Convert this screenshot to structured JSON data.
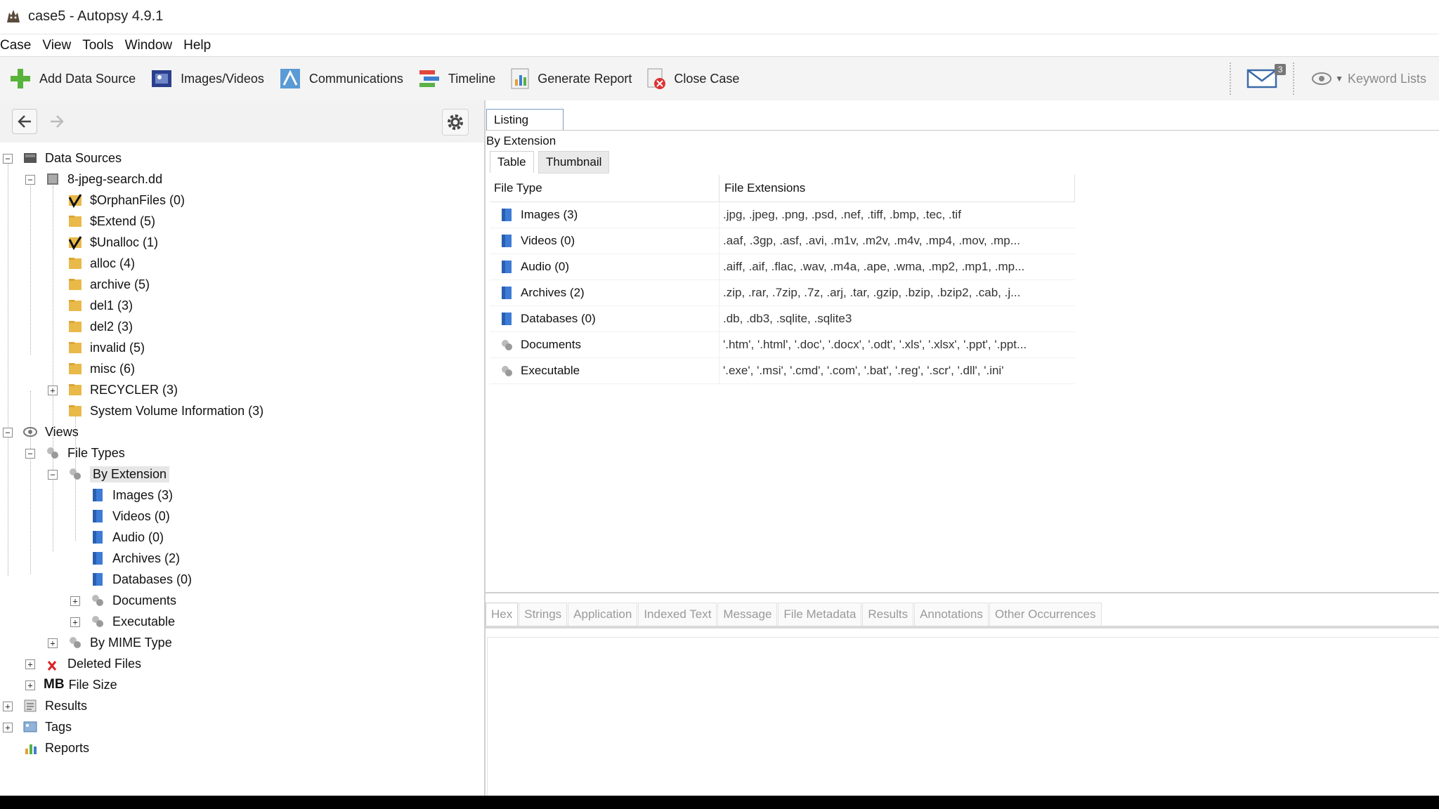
{
  "window": {
    "title": "case5 - Autopsy 4.9.1"
  },
  "menu": [
    "Case",
    "View",
    "Tools",
    "Window",
    "Help"
  ],
  "toolbar": {
    "add_data_source": "Add Data Source",
    "images_videos": "Images/Videos",
    "communications": "Communications",
    "timeline": "Timeline",
    "generate_report": "Generate Report",
    "close_case": "Close Case",
    "mail_badge": "3",
    "keyword_lists": "Keyword Lists"
  },
  "tree": {
    "data_sources": "Data Sources",
    "image": "8-jpeg-search.dd",
    "folders": [
      "$OrphanFiles (0)",
      "$Extend (5)",
      "$Unalloc (1)",
      "alloc (4)",
      "archive (5)",
      "del1 (3)",
      "del2 (3)",
      "invalid (5)",
      "misc (6)",
      "RECYCLER (3)",
      "System Volume Information (3)"
    ],
    "views": "Views",
    "file_types": "File Types",
    "by_extension": "By Extension",
    "ext_items": [
      "Images (3)",
      "Videos (0)",
      "Audio (0)",
      "Archives (2)",
      "Databases (0)",
      "Documents",
      "Executable"
    ],
    "by_mime": "By MIME Type",
    "deleted_files": "Deleted Files",
    "file_size_prefix": "MB",
    "file_size": "File Size",
    "results": "Results",
    "tags": "Tags",
    "reports": "Reports"
  },
  "listing": {
    "tab": "Listing",
    "breadcrumb": "By Extension",
    "view_tabs": [
      "Table",
      "Thumbnail"
    ],
    "columns": [
      "File Type",
      "File Extensions"
    ],
    "rows": [
      {
        "type": "Images (3)",
        "ext": ".jpg, .jpeg, .png, .psd, .nef, .tiff, .bmp, .tec, .tif"
      },
      {
        "type": "Videos (0)",
        "ext": ".aaf, .3gp, .asf, .avi, .m1v, .m2v, .m4v, .mp4, .mov, .mp..."
      },
      {
        "type": "Audio (0)",
        "ext": ".aiff, .aif, .flac, .wav, .m4a, .ape, .wma, .mp2, .mp1, .mp..."
      },
      {
        "type": "Archives (2)",
        "ext": ".zip, .rar, .7zip, .7z, .arj, .tar, .gzip, .bzip, .bzip2, .cab, .j..."
      },
      {
        "type": "Databases (0)",
        "ext": ".db, .db3, .sqlite, .sqlite3"
      },
      {
        "type": "Documents",
        "ext": "'.htm', '.html', '.doc', '.docx', '.odt', '.xls', '.xlsx', '.ppt', '.ppt..."
      },
      {
        "type": "Executable",
        "ext": "'.exe', '.msi', '.cmd', '.com', '.bat', '.reg', '.scr', '.dll', '.ini'"
      }
    ]
  },
  "content_tabs": [
    "Hex",
    "Strings",
    "Application",
    "Indexed Text",
    "Message",
    "File Metadata",
    "Results",
    "Annotations",
    "Other Occurrences"
  ]
}
